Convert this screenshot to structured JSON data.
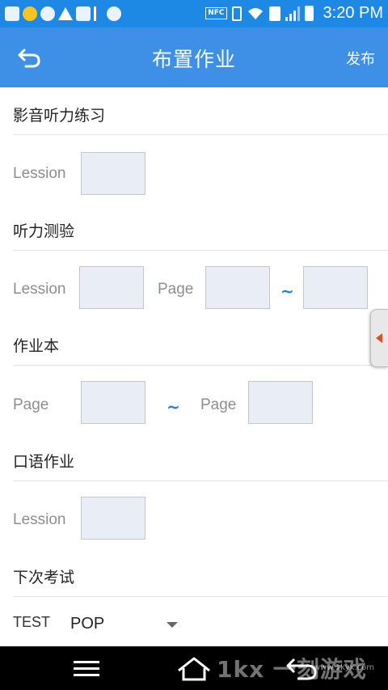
{
  "statusbar": {
    "nfc": "NFC",
    "time": "3:20 PM"
  },
  "appbar": {
    "title": "布置作业",
    "publish": "发布"
  },
  "sections": {
    "video_listening": {
      "title": "影音听力练习",
      "lesson_label": "Lession",
      "lesson_value": ""
    },
    "listening_test": {
      "title": "听力测验",
      "lesson_label": "Lession",
      "lesson_value": "",
      "page_label": "Page",
      "page_from": "",
      "tilde": "~",
      "page_to": ""
    },
    "workbook": {
      "title": "作业本",
      "page_label_from": "Page",
      "page_from": "",
      "tilde": "~",
      "page_label_to": "Page",
      "page_to": ""
    },
    "oral": {
      "title": "口语作业",
      "lesson_label": "Lession",
      "lesson_value": ""
    },
    "next_exam": {
      "title": "下次考试",
      "test_label": "TEST",
      "selected": "POP"
    }
  },
  "watermark": {
    "logo": "1kx 一刻游戏网",
    "url": "www.1kyx.com"
  },
  "icons": {
    "back": "back-arrow-icon",
    "side_tab": "chevron-left-icon",
    "nav": [
      "menu-icon",
      "home-icon",
      "back-icon"
    ]
  }
}
